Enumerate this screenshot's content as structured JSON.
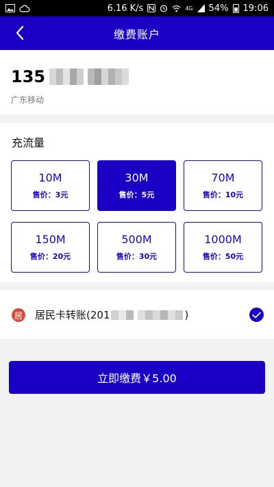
{
  "status_bar": {
    "speed": "6.16 K/s",
    "network": "4G",
    "battery": "54%",
    "time": "19:06",
    "icons": [
      "image-icon",
      "cloud-icon",
      "nfc-icon",
      "alarm-icon",
      "wifi-icon",
      "signal-icon",
      "battery-icon"
    ]
  },
  "header": {
    "title": "缴费账户",
    "back_icon": "chevron-left-icon"
  },
  "account": {
    "phone_prefix": "135",
    "carrier": "广东移动"
  },
  "traffic": {
    "title": "充流量",
    "packages": [
      {
        "amount": "10M",
        "price": "售价：3元",
        "selected": false
      },
      {
        "amount": "30M",
        "price": "售价：5元",
        "selected": true
      },
      {
        "amount": "70M",
        "price": "售价：10元",
        "selected": false
      },
      {
        "amount": "150M",
        "price": "售价：20元",
        "selected": false
      },
      {
        "amount": "500M",
        "price": "售价：30元",
        "selected": false
      },
      {
        "amount": "1000M",
        "price": "售价：50元",
        "selected": false
      }
    ]
  },
  "payment": {
    "icon_text": "居",
    "label_prefix": "居民卡转账(201",
    "label_suffix": ")",
    "checked": true
  },
  "pay_button": {
    "label": "立即缴费￥5.00"
  },
  "colors": {
    "primary": "#1a00c4",
    "payment_icon": "#d24b3c",
    "background": "#f2f2f2"
  }
}
